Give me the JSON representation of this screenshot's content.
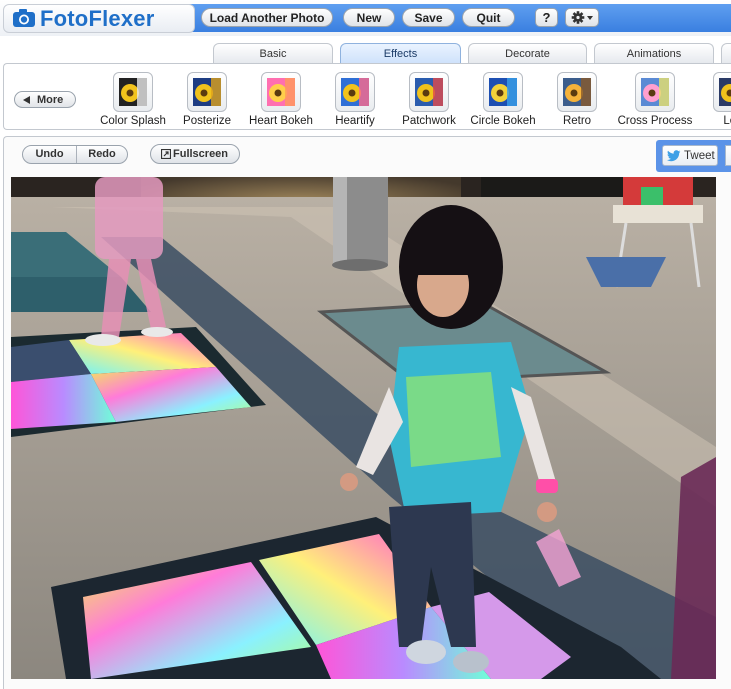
{
  "app": {
    "name": "FotoFlexer"
  },
  "toolbar": {
    "load_label": "Load Another Photo",
    "new_label": "New",
    "save_label": "Save",
    "quit_label": "Quit",
    "help_label": "?",
    "settings_icon": "gear-icon"
  },
  "tabs": [
    {
      "label": "Basic"
    },
    {
      "label": "Effects",
      "active": true
    },
    {
      "label": "Decorate"
    },
    {
      "label": "Animations"
    }
  ],
  "effects": {
    "more_label": "More",
    "items": [
      {
        "label": "Color Splash"
      },
      {
        "label": "Posterize"
      },
      {
        "label": "Heart Bokeh"
      },
      {
        "label": "Heartify"
      },
      {
        "label": "Patchwork"
      },
      {
        "label": "Circle Bokeh"
      },
      {
        "label": "Retro"
      },
      {
        "label": "Cross Process"
      },
      {
        "label": "Lon"
      }
    ]
  },
  "canvas_controls": {
    "undo_label": "Undo",
    "redo_label": "Redo",
    "fullscreen_label": "Fullscreen",
    "tweet_label": "Tweet"
  },
  "colors": {
    "brand": "#1f6fc8",
    "band": "#3a7fe0",
    "active_tab": "#cfe2fb"
  }
}
